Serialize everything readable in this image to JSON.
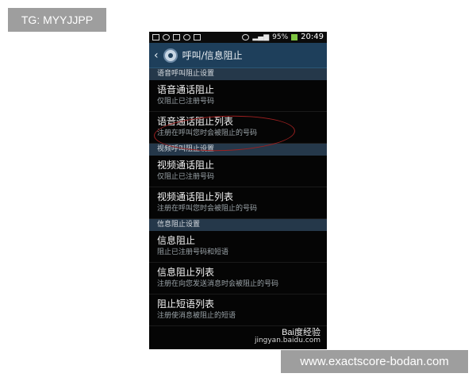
{
  "overlay": {
    "tg_label": "TG: MYYJJPP",
    "site_banner": "www.exactscore-bodan.com",
    "watermark_brand": "Bai度经验",
    "watermark_url": "jingyan.baidu.com"
  },
  "statusbar": {
    "battery": "95%",
    "time": "20:49"
  },
  "appbar": {
    "title": "呼叫/信息阻止"
  },
  "sections": [
    {
      "header": "语音呼叫阻止设置",
      "items": [
        {
          "title": "语音通话阻止",
          "subtitle": "仅阻止已注册号码"
        },
        {
          "title": "语音通话阻止列表",
          "subtitle": "注册在呼叫您时会被阻止的号码"
        }
      ]
    },
    {
      "header": "视频呼叫阻止设置",
      "items": [
        {
          "title": "视频通话阻止",
          "subtitle": "仅阻止已注册号码"
        },
        {
          "title": "视频通话阻止列表",
          "subtitle": "注册在呼叫您时会被阻止的号码"
        }
      ]
    },
    {
      "header": "信息阻止设置",
      "items": [
        {
          "title": "信息阻止",
          "subtitle": "阻止已注册号码和短语"
        },
        {
          "title": "信息阻止列表",
          "subtitle": "注册在向您发送消息时会被阻止的号码"
        },
        {
          "title": "阻止短语列表",
          "subtitle": "注册使消息被阻止的短语"
        }
      ]
    }
  ],
  "colors": {
    "appbar": "#1e3f5b",
    "section_header": "#25384a",
    "highlight_circle": "#9d2020"
  }
}
